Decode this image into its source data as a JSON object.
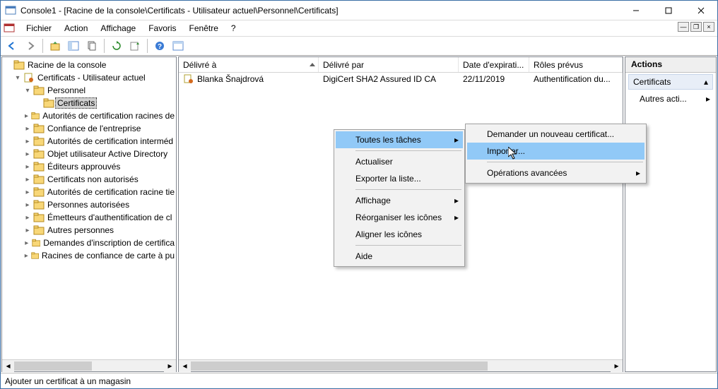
{
  "title": "Console1 - [Racine de la console\\Certificats - Utilisateur actuel\\Personnel\\Certificats]",
  "menus": {
    "fichier": "Fichier",
    "action": "Action",
    "affichage": "Affichage",
    "favoris": "Favoris",
    "fenetre": "Fenêtre",
    "aide": "?"
  },
  "tree": {
    "root": "Racine de la console",
    "certs_user": "Certificats - Utilisateur actuel",
    "personnel": "Personnel",
    "certificats": "Certificats",
    "items": [
      "Autorités de certification racines de",
      "Confiance de l'entreprise",
      "Autorités de certification interméd",
      "Objet utilisateur Active Directory",
      "Éditeurs approuvés",
      "Certificats non autorisés",
      "Autorités de certification racine tie",
      "Personnes autorisées",
      "Émetteurs d'authentification de cl",
      "Autres personnes",
      "Demandes d'inscription de certifica",
      "Racines de confiance de carte à pu"
    ]
  },
  "columns": {
    "issuedTo": "Délivré à",
    "issuedBy": "Délivré par",
    "exp": "Date d'expirati...",
    "roles": "Rôles prévus"
  },
  "row": {
    "to": "Blanka Šnajdrová",
    "by": "DigiCert SHA2 Assured ID CA",
    "exp": "22/11/2019",
    "roles": "Authentification du..."
  },
  "actions": {
    "header": "Actions",
    "sub": "Certificats",
    "other": "Autres acti..."
  },
  "status": "Ajouter un certificat à un magasin",
  "ctx1": {
    "all": "Toutes les tâches",
    "refresh": "Actualiser",
    "export": "Exporter la liste...",
    "view": "Affichage",
    "arrange": "Réorganiser les icônes",
    "align": "Aligner les icônes",
    "help": "Aide"
  },
  "ctx2": {
    "request": "Demander un nouveau certificat...",
    "import": "Importer...",
    "adv": "Opérations avancées"
  }
}
